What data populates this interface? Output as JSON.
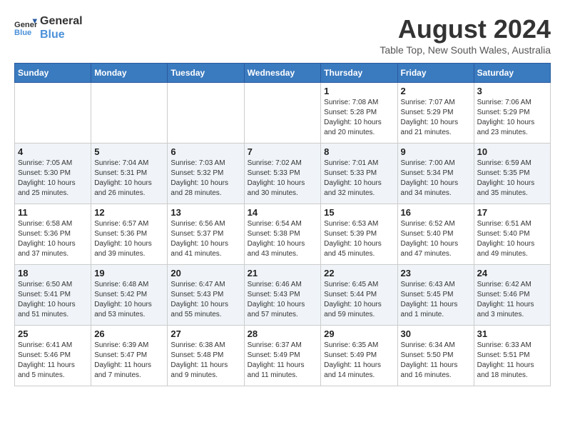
{
  "header": {
    "logo_line1": "General",
    "logo_line2": "Blue",
    "month": "August 2024",
    "location": "Table Top, New South Wales, Australia"
  },
  "weekdays": [
    "Sunday",
    "Monday",
    "Tuesday",
    "Wednesday",
    "Thursday",
    "Friday",
    "Saturday"
  ],
  "weeks": [
    [
      {
        "day": "",
        "info": ""
      },
      {
        "day": "",
        "info": ""
      },
      {
        "day": "",
        "info": ""
      },
      {
        "day": "",
        "info": ""
      },
      {
        "day": "1",
        "info": "Sunrise: 7:08 AM\nSunset: 5:28 PM\nDaylight: 10 hours\nand 20 minutes."
      },
      {
        "day": "2",
        "info": "Sunrise: 7:07 AM\nSunset: 5:29 PM\nDaylight: 10 hours\nand 21 minutes."
      },
      {
        "day": "3",
        "info": "Sunrise: 7:06 AM\nSunset: 5:29 PM\nDaylight: 10 hours\nand 23 minutes."
      }
    ],
    [
      {
        "day": "4",
        "info": "Sunrise: 7:05 AM\nSunset: 5:30 PM\nDaylight: 10 hours\nand 25 minutes."
      },
      {
        "day": "5",
        "info": "Sunrise: 7:04 AM\nSunset: 5:31 PM\nDaylight: 10 hours\nand 26 minutes."
      },
      {
        "day": "6",
        "info": "Sunrise: 7:03 AM\nSunset: 5:32 PM\nDaylight: 10 hours\nand 28 minutes."
      },
      {
        "day": "7",
        "info": "Sunrise: 7:02 AM\nSunset: 5:33 PM\nDaylight: 10 hours\nand 30 minutes."
      },
      {
        "day": "8",
        "info": "Sunrise: 7:01 AM\nSunset: 5:33 PM\nDaylight: 10 hours\nand 32 minutes."
      },
      {
        "day": "9",
        "info": "Sunrise: 7:00 AM\nSunset: 5:34 PM\nDaylight: 10 hours\nand 34 minutes."
      },
      {
        "day": "10",
        "info": "Sunrise: 6:59 AM\nSunset: 5:35 PM\nDaylight: 10 hours\nand 35 minutes."
      }
    ],
    [
      {
        "day": "11",
        "info": "Sunrise: 6:58 AM\nSunset: 5:36 PM\nDaylight: 10 hours\nand 37 minutes."
      },
      {
        "day": "12",
        "info": "Sunrise: 6:57 AM\nSunset: 5:36 PM\nDaylight: 10 hours\nand 39 minutes."
      },
      {
        "day": "13",
        "info": "Sunrise: 6:56 AM\nSunset: 5:37 PM\nDaylight: 10 hours\nand 41 minutes."
      },
      {
        "day": "14",
        "info": "Sunrise: 6:54 AM\nSunset: 5:38 PM\nDaylight: 10 hours\nand 43 minutes."
      },
      {
        "day": "15",
        "info": "Sunrise: 6:53 AM\nSunset: 5:39 PM\nDaylight: 10 hours\nand 45 minutes."
      },
      {
        "day": "16",
        "info": "Sunrise: 6:52 AM\nSunset: 5:40 PM\nDaylight: 10 hours\nand 47 minutes."
      },
      {
        "day": "17",
        "info": "Sunrise: 6:51 AM\nSunset: 5:40 PM\nDaylight: 10 hours\nand 49 minutes."
      }
    ],
    [
      {
        "day": "18",
        "info": "Sunrise: 6:50 AM\nSunset: 5:41 PM\nDaylight: 10 hours\nand 51 minutes."
      },
      {
        "day": "19",
        "info": "Sunrise: 6:48 AM\nSunset: 5:42 PM\nDaylight: 10 hours\nand 53 minutes."
      },
      {
        "day": "20",
        "info": "Sunrise: 6:47 AM\nSunset: 5:43 PM\nDaylight: 10 hours\nand 55 minutes."
      },
      {
        "day": "21",
        "info": "Sunrise: 6:46 AM\nSunset: 5:43 PM\nDaylight: 10 hours\nand 57 minutes."
      },
      {
        "day": "22",
        "info": "Sunrise: 6:45 AM\nSunset: 5:44 PM\nDaylight: 10 hours\nand 59 minutes."
      },
      {
        "day": "23",
        "info": "Sunrise: 6:43 AM\nSunset: 5:45 PM\nDaylight: 11 hours\nand 1 minute."
      },
      {
        "day": "24",
        "info": "Sunrise: 6:42 AM\nSunset: 5:46 PM\nDaylight: 11 hours\nand 3 minutes."
      }
    ],
    [
      {
        "day": "25",
        "info": "Sunrise: 6:41 AM\nSunset: 5:46 PM\nDaylight: 11 hours\nand 5 minutes."
      },
      {
        "day": "26",
        "info": "Sunrise: 6:39 AM\nSunset: 5:47 PM\nDaylight: 11 hours\nand 7 minutes."
      },
      {
        "day": "27",
        "info": "Sunrise: 6:38 AM\nSunset: 5:48 PM\nDaylight: 11 hours\nand 9 minutes."
      },
      {
        "day": "28",
        "info": "Sunrise: 6:37 AM\nSunset: 5:49 PM\nDaylight: 11 hours\nand 11 minutes."
      },
      {
        "day": "29",
        "info": "Sunrise: 6:35 AM\nSunset: 5:49 PM\nDaylight: 11 hours\nand 14 minutes."
      },
      {
        "day": "30",
        "info": "Sunrise: 6:34 AM\nSunset: 5:50 PM\nDaylight: 11 hours\nand 16 minutes."
      },
      {
        "day": "31",
        "info": "Sunrise: 6:33 AM\nSunset: 5:51 PM\nDaylight: 11 hours\nand 18 minutes."
      }
    ]
  ]
}
